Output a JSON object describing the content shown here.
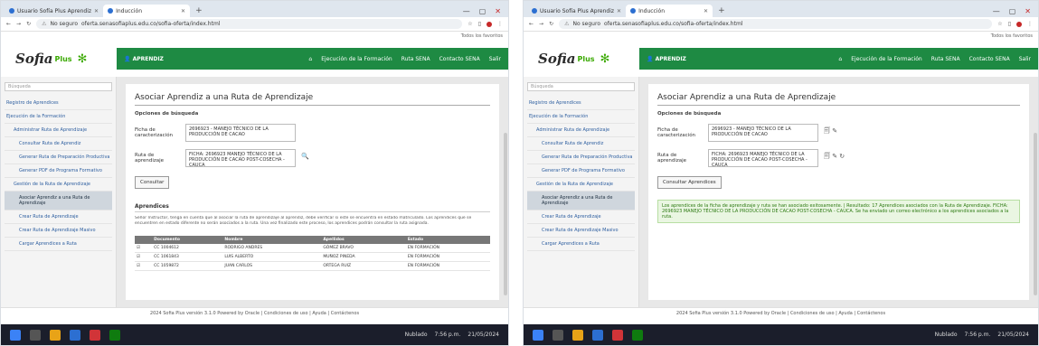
{
  "shots": [
    {
      "tabs": [
        "Usuario Sofía Plus Aprendiz",
        "Inducción"
      ],
      "url": "oferta.senasofiaplus.edu.co/sofia-oferta/index.html",
      "address_prefix": "No seguro",
      "bookmarks_label": "Todos los favoritos",
      "logo_text": "Sofia",
      "logo_plus": "Plus",
      "role": "APRENDIZ",
      "top_menu": [
        "Ejecución de la Formación",
        "Ruta SENA",
        "Contacto SENA",
        "Salir"
      ],
      "sidebar": [
        {
          "label": "Búsqueda",
          "level": 0,
          "selected": false
        },
        {
          "label": "Registro de Aprendices",
          "level": 0,
          "selected": false
        },
        {
          "label": "Ejecución de la Formación",
          "level": 0,
          "selected": false
        },
        {
          "label": "Administrar Ruta de Aprendizaje",
          "level": 1,
          "selected": false
        },
        {
          "label": "Consultar Ruta de Aprendiz",
          "level": 2,
          "selected": false
        },
        {
          "label": "Generar Ruta de Preparación Productiva",
          "level": 2,
          "selected": false
        },
        {
          "label": "Generar PDF de Programa Formativo",
          "level": 2,
          "selected": false
        },
        {
          "label": "Gestión de la Ruta de Aprendizaje",
          "level": 1,
          "selected": false
        },
        {
          "label": "Asociar Aprendiz a una Ruta de Aprendizaje",
          "level": 2,
          "selected": true
        },
        {
          "label": "Crear Ruta de Aprendizaje",
          "level": 2,
          "selected": false
        },
        {
          "label": "Crear Ruta de Aprendizaje Masivo",
          "level": 2,
          "selected": false
        },
        {
          "label": "Cargar Aprendices a Ruta",
          "level": 2,
          "selected": false
        }
      ],
      "search_placeholder": "Búsqueda",
      "page_title": "Asociar Aprendiz a una Ruta de Aprendizaje",
      "subheader": "Opciones de búsqueda",
      "fields": [
        {
          "label": "Ficha de caracterización",
          "value": "2696923 - MANEJO TÉCNICO DE LA PRODUCCIÓN DE CACAO",
          "icon": ""
        },
        {
          "label": "Ruta de aprendizaje",
          "value": "FICHA: 2696923 MANEJO TÉCNICO DE LA PRODUCCIÓN DE CACAO POST-COSECHA - CAUCA",
          "icon": "🔍"
        }
      ],
      "button": "Consultar",
      "section": "Aprendices",
      "note": "Señor Instructor, tenga en cuenta que al asociar la ruta de aprendizaje al aprendiz, debe verificar si este se encuentra en estado matriculado. Los aprendices que se encuentren en estado diferente no serán asociados a la ruta. Una vez finalizado este proceso, los aprendices podrán consultar la ruta asignada.",
      "table_headers": [
        "",
        "Documento",
        "Nombre",
        "Apellidos",
        "Estado"
      ],
      "table_rows": [
        [
          "☑",
          "CC 1004612",
          "RODRIGO ANDRES",
          "GÓMEZ BRAVO",
          "EN FORMACIÓN"
        ],
        [
          "☑",
          "CC 1061843",
          "LUIS ALBERTO",
          "MUÑOZ PINEDA",
          "EN FORMACIÓN"
        ],
        [
          "☑",
          "CC 1059872",
          "JUAN CARLOS",
          "ORTEGA RUIZ",
          "EN FORMACIÓN"
        ]
      ],
      "message": "",
      "footer": "2024 Sofia Plus versión 3.1.0 Powered by Oracle | Condiciones de uso | Ayuda | Contáctenos"
    },
    {
      "tabs": [
        "Usuario Sofía Plus Aprendiz",
        "Inducción"
      ],
      "url": "oferta.senasofiaplus.edu.co/sofia-oferta/index.html",
      "address_prefix": "No seguro",
      "bookmarks_label": "Todos los favoritos",
      "logo_text": "Sofia",
      "logo_plus": "Plus",
      "role": "APRENDIZ",
      "top_menu": [
        "Ejecución de la Formación",
        "Ruta SENA",
        "Contacto SENA",
        "Salir"
      ],
      "sidebar": [
        {
          "label": "Búsqueda",
          "level": 0,
          "selected": false
        },
        {
          "label": "Registro de Aprendices",
          "level": 0,
          "selected": false
        },
        {
          "label": "Ejecución de la Formación",
          "level": 0,
          "selected": false
        },
        {
          "label": "Administrar Ruta de Aprendizaje",
          "level": 1,
          "selected": false
        },
        {
          "label": "Consultar Ruta de Aprendiz",
          "level": 2,
          "selected": false
        },
        {
          "label": "Generar Ruta de Preparación Productiva",
          "level": 2,
          "selected": false
        },
        {
          "label": "Generar PDF de Programa Formativo",
          "level": 2,
          "selected": false
        },
        {
          "label": "Gestión de la Ruta de Aprendizaje",
          "level": 1,
          "selected": false
        },
        {
          "label": "Asociar Aprendiz a una Ruta de Aprendizaje",
          "level": 2,
          "selected": true
        },
        {
          "label": "Crear Ruta de Aprendizaje",
          "level": 2,
          "selected": false
        },
        {
          "label": "Crear Ruta de Aprendizaje Masivo",
          "level": 2,
          "selected": false
        },
        {
          "label": "Cargar Aprendices a Ruta",
          "level": 2,
          "selected": false
        }
      ],
      "search_placeholder": "Búsqueda",
      "page_title": "Asociar Aprendiz a una Ruta de Aprendizaje",
      "subheader": "Opciones de búsqueda",
      "fields": [
        {
          "label": "Ficha de caracterización",
          "value": "2696923 - MANEJO TÉCNICO DE LA PRODUCCIÓN DE CACAO",
          "icon": "🗐 ✎"
        },
        {
          "label": "Ruta de aprendizaje",
          "value": "FICHA: 2696923 MANEJO TÉCNICO DE LA PRODUCCIÓN DE CACAO POST-COSECHA - CAUCA",
          "icon": "🗐 ✎ ↻"
        }
      ],
      "button": "Consultar Aprendices",
      "section": "",
      "note": "",
      "table_headers": [],
      "table_rows": [],
      "message": "Los aprendices de la ficha de aprendizaje y ruta se han asociado exitosamente. | Resultado: 17 Aprendices asociados con la Ruta de Aprendizaje. FICHA: 2696923 MANEJO TÉCNICO DE LA PRODUCCIÓN DE CACAO POST-COSECHA - CAUCA. Se ha enviado un correo electrónico a los aprendices asociados a la ruta.",
      "footer": "2024 Sofia Plus versión 3.1.0 Powered by Oracle | Condiciones de uso | Ayuda | Contáctenos"
    }
  ],
  "taskbar": {
    "tray_text": "Nublado",
    "time": "7:56 p.m.",
    "date": "21/05/2024"
  },
  "colors": {
    "sena_green": "#1e8a43",
    "logo_green": "#39a900",
    "link_blue": "#2e5fa0",
    "success_text": "#2d7a12"
  }
}
